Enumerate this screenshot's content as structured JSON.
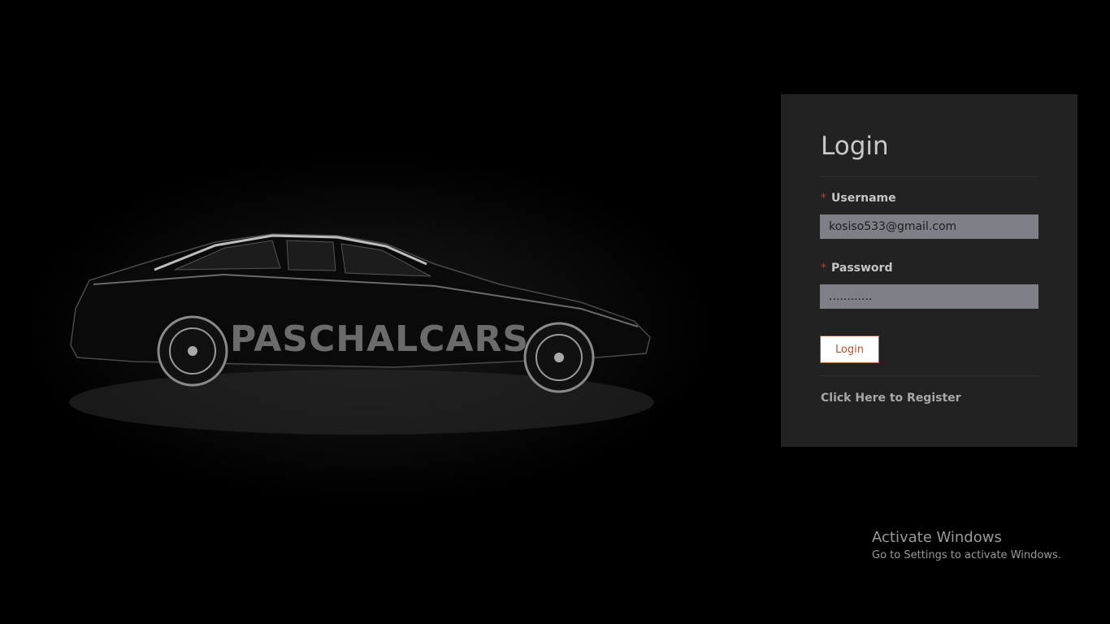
{
  "hero": {
    "brand_text": "PASCHALCARS"
  },
  "login": {
    "title": "Login",
    "username_label": "Username",
    "username_value": "kosiso533@gmail.com",
    "password_label": "Password",
    "password_value": "............",
    "required_marker": "*",
    "submit_label": "Login",
    "register_link": "Click Here to Register"
  },
  "watermark": {
    "title": "Activate Windows",
    "subtitle": "Go to Settings to activate Windows."
  },
  "colors": {
    "accent": "#b5532c",
    "panel_bg": "#222222",
    "input_bg": "#7d8087"
  }
}
